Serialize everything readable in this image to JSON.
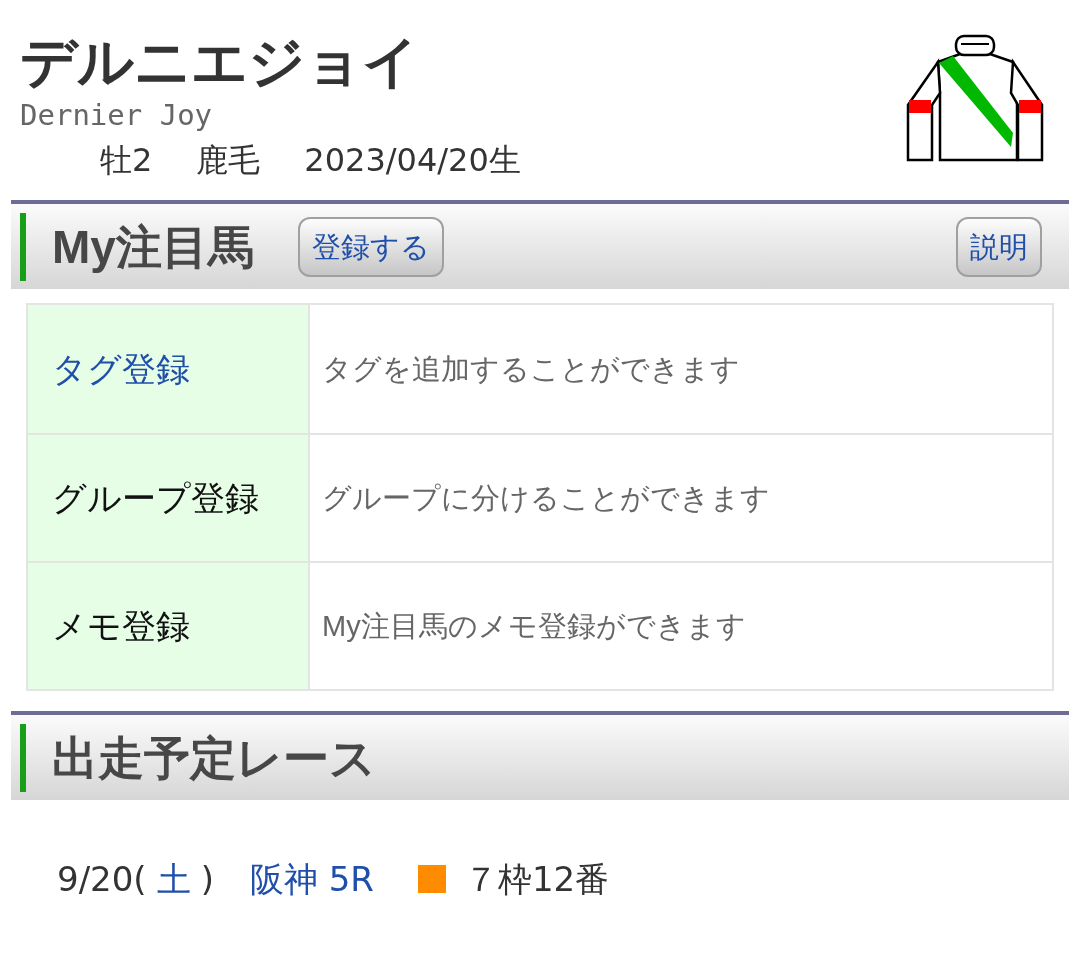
{
  "horse": {
    "name": "デルニエジョイ",
    "name_en": "Dernier Joy",
    "profile": [
      "牡2",
      "鹿毛",
      "2023/04/20生"
    ]
  },
  "my_favorite": {
    "title": "My注目馬",
    "buttons": [
      {
        "label": "登録する"
      },
      {
        "label": "説明"
      }
    ],
    "rows": [
      {
        "label": "タグ登録",
        "link": true,
        "description": "タグを追加することができます"
      },
      {
        "label": "グループ登録",
        "link": false,
        "description": "グループに分けることができます"
      },
      {
        "label": "メモ登録",
        "link": false,
        "description": "My注目馬のメモ登録ができます"
      }
    ]
  },
  "races": {
    "title": "出走予定レース",
    "entries": [
      {
        "date": "9/20(",
        "weekday": {
          "text": "土",
          "color": "#1f4fa8"
        },
        "date_close": ")",
        "venue": "阪神 5R",
        "color": "#ff8c00",
        "post": "７枠12番"
      }
    ]
  }
}
